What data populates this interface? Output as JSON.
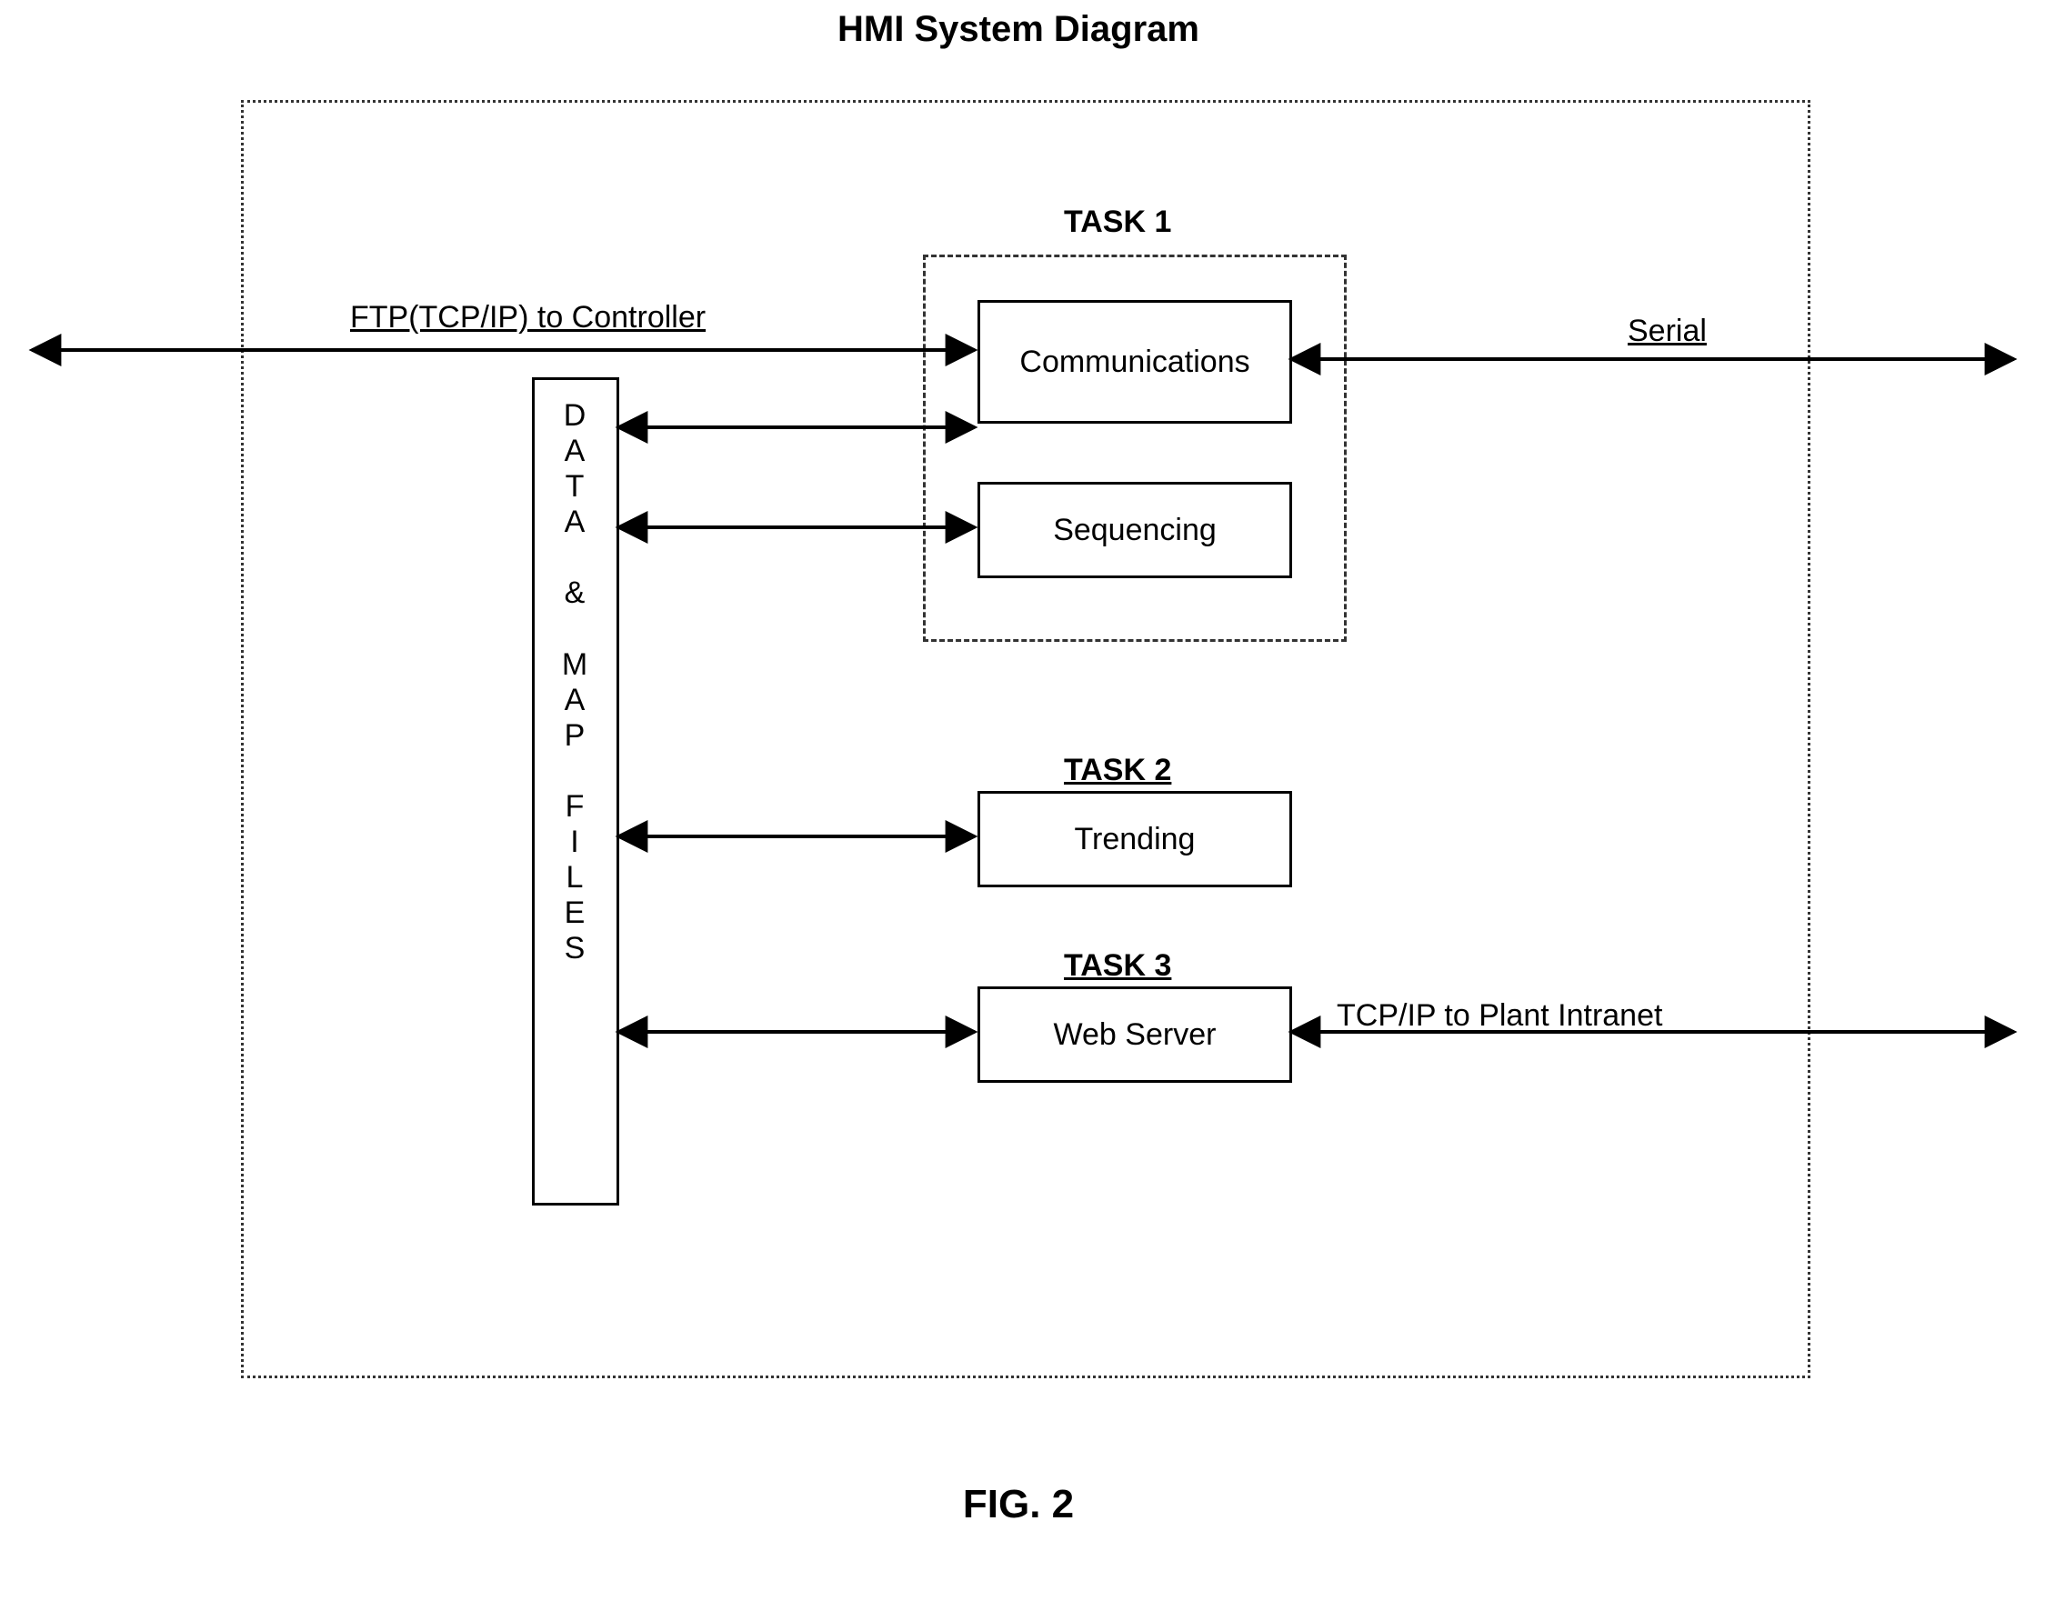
{
  "title": "HMI System Diagram",
  "figure_label": "FIG. 2",
  "data_block_label": "D\nA\nT\nA\n\n&\n\nM\nA\nP\n\nF\nI\nL\nE\nS",
  "task1": {
    "label": "TASK 1",
    "communications": "Communications",
    "sequencing": "Sequencing"
  },
  "task2": {
    "label": "TASK 2",
    "trending": "Trending"
  },
  "task3": {
    "label": "TASK 3",
    "webserver": "Web Server"
  },
  "arrows": {
    "ftp_label": "FTP(TCP/IP)  to Controller",
    "serial_label": "Serial",
    "tcpip_label": "TCP/IP to Plant Intranet"
  }
}
